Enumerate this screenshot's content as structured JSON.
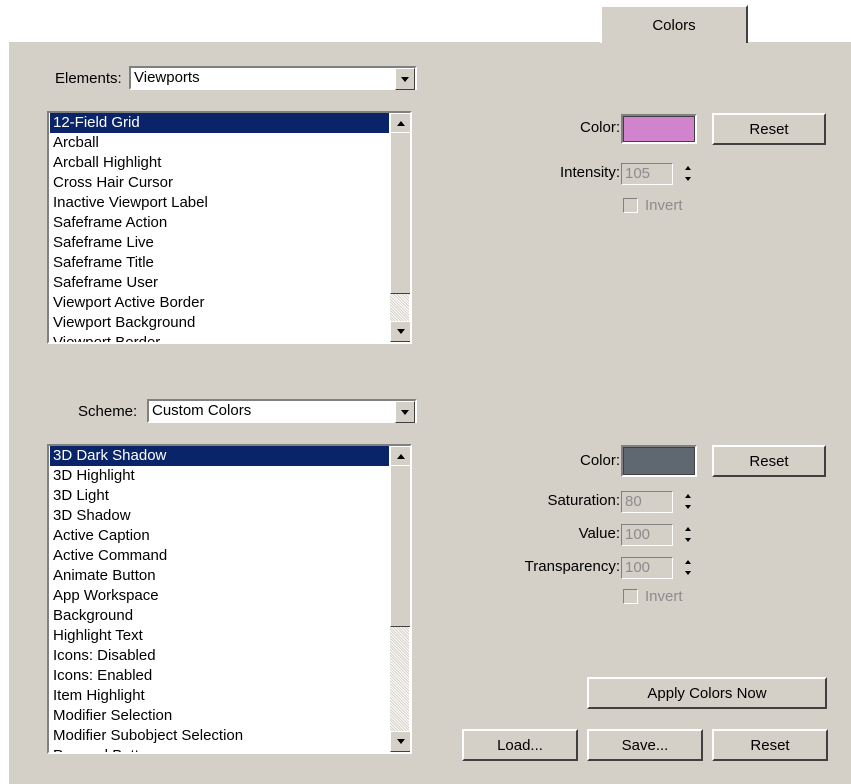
{
  "tab": {
    "label": "Colors"
  },
  "elements_section": {
    "label": "Elements:",
    "selected": "Viewports",
    "items": [
      "12-Field Grid",
      "Arcball",
      "Arcball Highlight",
      "Cross Hair Cursor",
      "Inactive Viewport Label",
      "Safeframe Action",
      "Safeframe Live",
      "Safeframe Title",
      "Safeframe User",
      "Viewport Active Border",
      "Viewport Background",
      "Viewport Border"
    ],
    "selected_item": "12-Field Grid",
    "color_label": "Color:",
    "color_value": "#d283cd",
    "reset_label": "Reset",
    "intensity_label": "Intensity:",
    "intensity_value": "105",
    "invert_label": "Invert"
  },
  "scheme_section": {
    "label": "Scheme:",
    "selected": "Custom Colors",
    "items": [
      "3D Dark Shadow",
      "3D Highlight",
      "3D Light",
      "3D Shadow",
      "Active Caption",
      "Active Command",
      "Animate Button",
      "App Workspace",
      "Background",
      "Highlight Text",
      "Icons: Disabled",
      "Icons: Enabled",
      "Item Highlight",
      "Modifier Selection",
      "Modifier Subobject Selection",
      "Pressed Buttons"
    ],
    "selected_item": "3D Dark Shadow",
    "color_label": "Color:",
    "color_value": "#5f6770",
    "reset_label": "Reset",
    "saturation_label": "Saturation:",
    "saturation_value": "80",
    "value_label": "Value:",
    "value_value": "100",
    "transparency_label": "Transparency:",
    "transparency_value": "100",
    "invert_label": "Invert"
  },
  "buttons": {
    "apply": "Apply Colors Now",
    "load": "Load...",
    "save": "Save...",
    "reset": "Reset"
  },
  "colors": {
    "panel": "#d4d0c8",
    "selection": "#0a246a"
  }
}
